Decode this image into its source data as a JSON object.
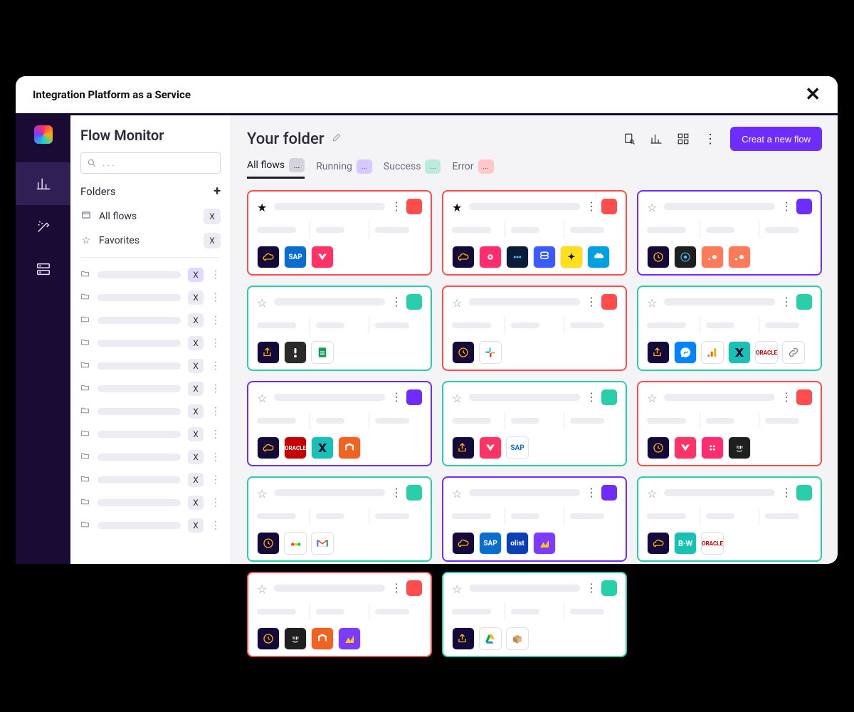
{
  "titlebar": {
    "title": "Integration Platform as a Service"
  },
  "sidebar": {
    "heading": "Flow Monitor",
    "search_placeholder": ". . .",
    "folders_label": "Folders",
    "allflows_label": "All flows",
    "allflows_count": "X",
    "favorites_label": "Favorites",
    "favorites_count": "X",
    "subfolders": [
      {
        "count": "X",
        "selected": true
      },
      {
        "count": "X"
      },
      {
        "count": "X"
      },
      {
        "count": "X"
      },
      {
        "count": "X"
      },
      {
        "count": "X"
      },
      {
        "count": "X"
      },
      {
        "count": "X"
      },
      {
        "count": "X"
      },
      {
        "count": "X"
      },
      {
        "count": "X"
      },
      {
        "count": "X"
      }
    ]
  },
  "main": {
    "title": "Your folder",
    "new_button": "Creat a new flow",
    "tabs": [
      {
        "label": "All flows",
        "chip": "...",
        "chip_color": "gray",
        "active": true
      },
      {
        "label": "Running",
        "chip": "...",
        "chip_color": "purple"
      },
      {
        "label": "Success",
        "chip": "...",
        "chip_color": "teal"
      },
      {
        "label": "Error",
        "chip": "...",
        "chip_color": "red"
      }
    ],
    "cards": [
      {
        "status": "red",
        "fav": true,
        "apps": [
          "cloud",
          "sap",
          "vtex"
        ]
      },
      {
        "status": "red",
        "fav": true,
        "apps": [
          "cloud",
          "target",
          "podio",
          "capsule",
          "mailchimp",
          "salesforce"
        ]
      },
      {
        "status": "purple",
        "fav": false,
        "apps": [
          "clock",
          "ibm",
          "hubspot",
          "hubspot"
        ]
      },
      {
        "status": "teal",
        "fav": false,
        "apps": [
          "share",
          "indeed",
          "sheets"
        ]
      },
      {
        "status": "red",
        "fav": false,
        "apps": [
          "clock",
          "slack"
        ]
      },
      {
        "status": "teal",
        "fav": false,
        "apps": [
          "share",
          "messenger",
          "ga",
          "x-teal",
          "oraclecc",
          "link-ic"
        ]
      },
      {
        "status": "purple",
        "fav": false,
        "apps": [
          "cloud",
          "oracle",
          "x-teal",
          "magento"
        ]
      },
      {
        "status": "teal",
        "fav": false,
        "apps": [
          "share",
          "vtex",
          "sap-white"
        ]
      },
      {
        "status": "red",
        "fav": false,
        "apps": [
          "clock",
          "vtex",
          "twilio",
          "intercom"
        ]
      },
      {
        "status": "teal",
        "fav": false,
        "apps": [
          "clock",
          "monday",
          "gmail"
        ]
      },
      {
        "status": "purple",
        "fav": false,
        "apps": [
          "cloud",
          "sap",
          "olist",
          "climb"
        ]
      },
      {
        "status": "teal",
        "fav": false,
        "apps": [
          "cloud",
          "bw",
          "oraclecc"
        ]
      },
      {
        "status": "red",
        "fav": false,
        "apps": [
          "clock",
          "intercom",
          "magento",
          "climb"
        ]
      },
      {
        "status": "teal",
        "fav": false,
        "apps": [
          "share",
          "drive",
          "box"
        ]
      }
    ]
  }
}
